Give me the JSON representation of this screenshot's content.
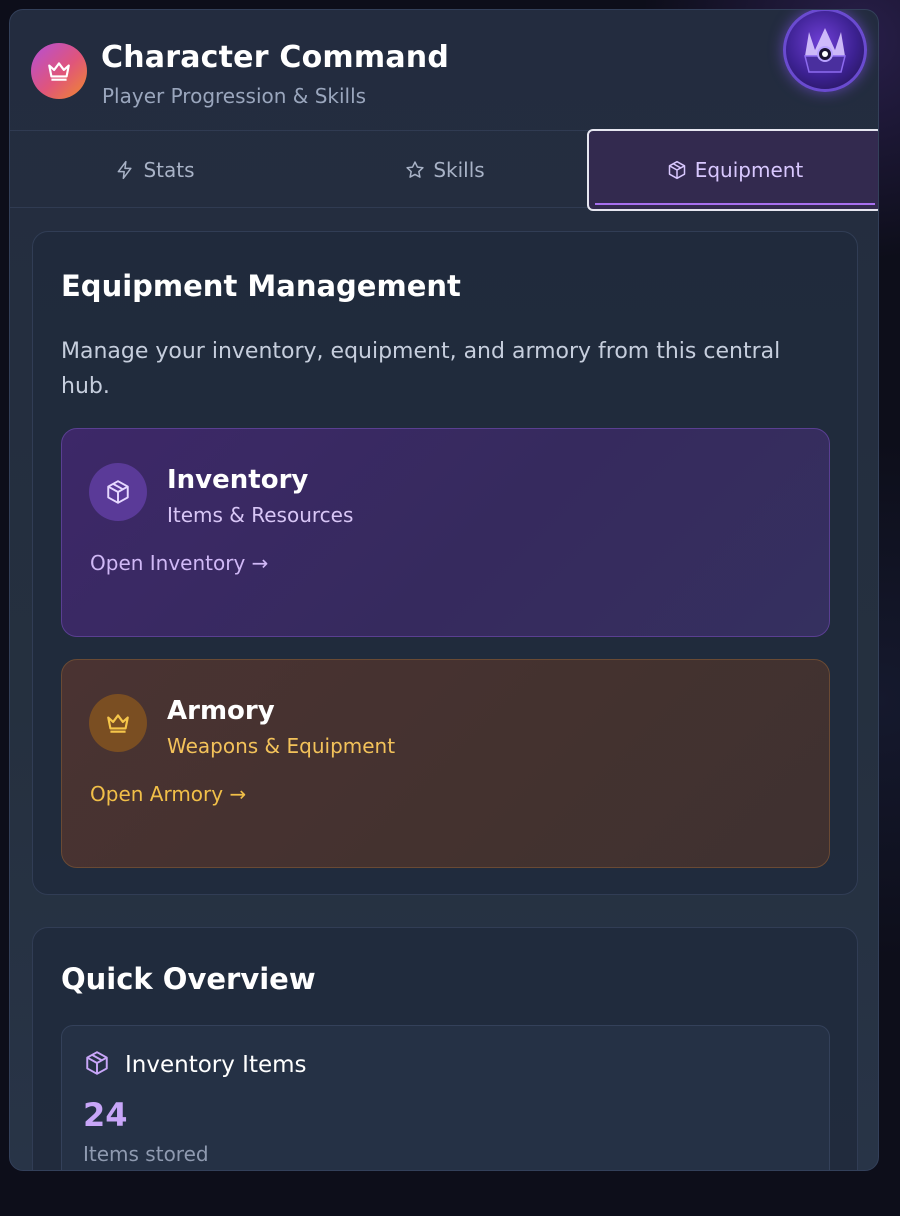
{
  "header": {
    "title": "Character Command",
    "subtitle": "Player Progression & Skills",
    "logo_icon": "crown-icon",
    "avatar_icon": "character-avatar"
  },
  "tabs": [
    {
      "label": "Stats",
      "icon": "lightning-icon",
      "active": false
    },
    {
      "label": "Skills",
      "icon": "star-icon",
      "active": false
    },
    {
      "label": "Equipment",
      "icon": "cube-icon",
      "active": true
    }
  ],
  "equipment": {
    "title": "Equipment Management",
    "description": "Manage your inventory, equipment, and armory from this central hub.",
    "inventory": {
      "title": "Inventory",
      "caption": "Items & Resources",
      "link": "Open Inventory →",
      "icon": "cube-icon"
    },
    "armory": {
      "title": "Armory",
      "caption": "Weapons & Equipment",
      "link": "Open Armory →",
      "icon": "crown-icon"
    }
  },
  "overview": {
    "title": "Quick Overview",
    "stat": {
      "label": "Inventory Items",
      "value": "24",
      "caption": "Items stored",
      "icon": "cube-icon"
    }
  },
  "colors": {
    "accent_purple": "#a870f0",
    "accent_gold": "#f1bf48",
    "panel_bg": "#232c3f"
  }
}
